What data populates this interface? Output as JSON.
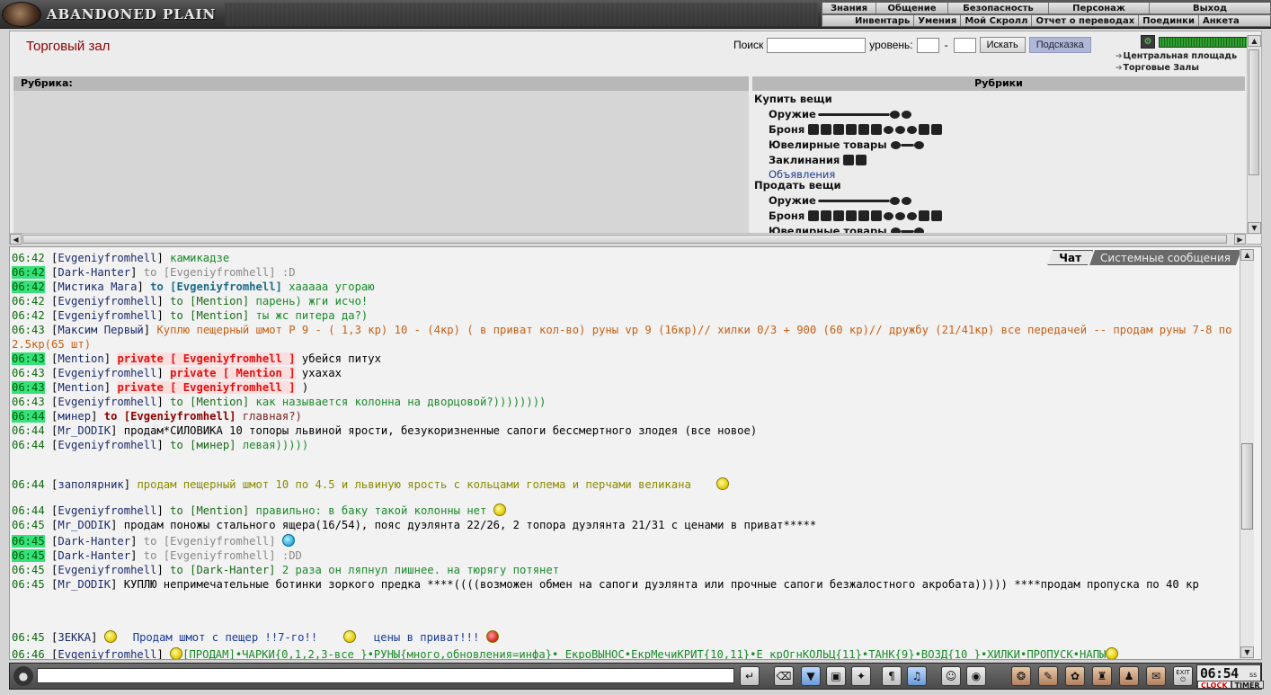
{
  "app": {
    "logo_text": "ABANDONED PLAIN"
  },
  "menu": {
    "top": [
      "Знания",
      "Общение",
      "Безопасность",
      "Персонаж",
      "Выход"
    ],
    "bottom": [
      "Инвентарь",
      "Умения",
      "Мой Скролл",
      "Отчет о переводах",
      "Поединки",
      "Анкета"
    ]
  },
  "page": {
    "title": "Торговый зал"
  },
  "search": {
    "label": "Поиск",
    "level_label": "уровень:",
    "dash": "-",
    "search_button": "Искать",
    "hint_button": "Подсказка"
  },
  "locations": [
    "Центральная площадь",
    "Торговые Залы"
  ],
  "rubric": {
    "header": "Рубрика:"
  },
  "rubrics": {
    "header": "Рубрики",
    "buy": "Купить вещи",
    "sell": "Продать вещи",
    "weapons": "Оружие",
    "armor": "Броня",
    "jewelry": "Ювелирные товары",
    "spells": "Заклинания",
    "ads": "Объявления"
  },
  "chat_tabs": {
    "chat": "Чат",
    "system": "Системные сообщения"
  },
  "chat": [
    {
      "time": "06:42",
      "hl": false,
      "nick": "Evgeniyfromhell",
      "to": "",
      "to_style": "",
      "msg": "камикадзе",
      "msg_style": "green"
    },
    {
      "time": "06:42",
      "hl": true,
      "nick": "Dark-Hanter",
      "to": "to [Evgeniyfromhell]",
      "to_style": "g",
      "msg": ":D",
      "msg_style": "gray"
    },
    {
      "time": "06:42",
      "hl": true,
      "nick": "Мистика Мага",
      "to": "to [Evgeniyfromhell]",
      "to_style": "bl",
      "msg": "хааааа угораю",
      "msg_style": "green"
    },
    {
      "time": "06:42",
      "hl": false,
      "nick": "Evgeniyfromhell",
      "to": "to [Mention]",
      "to_style": "",
      "msg": "парень) жги исчо!",
      "msg_style": "green"
    },
    {
      "time": "06:42",
      "hl": false,
      "nick": "Evgeniyfromhell",
      "to": "to [Mention]",
      "to_style": "",
      "msg": "ты жс питера да?)",
      "msg_style": "green"
    },
    {
      "time": "06:43",
      "hl": false,
      "nick": "Максим Первый",
      "to": "",
      "to_style": "",
      "msg": "Куплю пещерный шмот Р 9 - ( 1,3 кр) 10 - (4кр) ( в приват кол-во) руны vp 9 (16кр)// хилки 0/3 + 900 (60 кр)// дружбу (21/41кр) все передачей -- продам руны 7-8 по 2.5кр(65 шт)",
      "msg_style": "orange"
    },
    {
      "time": "06:43",
      "hl": true,
      "nick": "Mention",
      "to": "private [ Evgeniyfromhell ]",
      "to_style": "pv",
      "msg": "убейся питух",
      "msg_style": "black"
    },
    {
      "time": "06:43",
      "hl": false,
      "nick": "Evgeniyfromhell",
      "to": "private [ Mention ]",
      "to_style": "pv",
      "msg": "ухахах",
      "msg_style": "black"
    },
    {
      "time": "06:43",
      "hl": true,
      "nick": "Mention",
      "to": "private [ Evgeniyfromhell ]",
      "to_style": "pv",
      "msg": ")",
      "msg_style": "black"
    },
    {
      "time": "06:43",
      "hl": false,
      "nick": "Evgeniyfromhell",
      "to": "to [Mention]",
      "to_style": "",
      "msg": "как называется колонна на дворцовой?))))))))",
      "msg_style": "green"
    },
    {
      "time": "06:44",
      "hl": true,
      "nick": "минер",
      "to": "to [Evgeniyfromhell]",
      "to_style": "dk",
      "msg": "главная?)",
      "msg_style": "brown"
    },
    {
      "time": "06:44",
      "hl": false,
      "nick": "Mr_DODIK",
      "to": "",
      "to_style": "",
      "msg": "продам*СИЛОВИКА 10 топоры львиной ярости, безукоризненные сапоги бессмертного злодея (все новое)",
      "msg_style": "black"
    },
    {
      "time": "06:44",
      "hl": false,
      "nick": "Evgeniyfromhell",
      "to": "to [минер]",
      "to_style": "",
      "msg": "левая)))))",
      "msg_style": "green"
    },
    {
      "time": "06:44",
      "hl": false,
      "nick": "заполярник",
      "to": "",
      "to_style": "",
      "msg": "продам пещерный шмот 10 по 4.5 и львиную ярость с кольцами голема и перчами великана",
      "msg_style": "olive"
    },
    {
      "time": "06:44",
      "hl": false,
      "nick": "Evgeniyfromhell",
      "to": "to [Mention]",
      "to_style": "",
      "msg": "правильно: в баку такой колонны нет",
      "msg_style": "green"
    },
    {
      "time": "06:45",
      "hl": false,
      "nick": "Mr_DODIK",
      "to": "",
      "to_style": "",
      "msg": "продам поножы стального ящера(16/54), пояс дуэлянта 22/26, 2 топора дуэлянта 21/31 с ценами в приват*****",
      "msg_style": "black"
    },
    {
      "time": "06:45",
      "hl": true,
      "nick": "Dark-Hanter",
      "to": "to [Evgeniyfromhell]",
      "to_style": "g",
      "msg": "",
      "msg_style": "gray"
    },
    {
      "time": "06:45",
      "hl": true,
      "nick": "Dark-Hanter",
      "to": "to [Evgeniyfromhell]",
      "to_style": "g",
      "msg": ":DD",
      "msg_style": "gray"
    },
    {
      "time": "06:45",
      "hl": false,
      "nick": "Evgeniyfromhell",
      "to": "to [Dark-Hanter]",
      "to_style": "",
      "msg": "2 раза он ляпнул лишнее. на тюрягу потянет",
      "msg_style": "green"
    },
    {
      "time": "06:45",
      "hl": false,
      "nick": "Mr_DODIK",
      "to": "",
      "to_style": "",
      "msg": "КУПЛЮ непримечательные ботинки зоркого предка ****((((возможен обмен на сапоги дуэлянта или прочные сапоги безжалостного акробата))))) ****продам пропуска по 40 кр",
      "msg_style": "black"
    },
    {
      "time": "06:45",
      "hl": false,
      "nick": "ЗЕККА",
      "to": "",
      "to_style": "",
      "msg": "Продам шмот с пещер !!7-го!!",
      "msg2": "цены в приват!!!",
      "msg_style": "blue"
    },
    {
      "time": "06:46",
      "hl": false,
      "nick": "Evgeniyfromhell",
      "to": "",
      "to_style": "",
      "msg": "[ПРОДАМ]•ЧАРКИ{0,1,2,3-все }•РУНЫ{много,обновления=инфа}• ЕкроВЫНОС•ЕкрМечиКРИТ{10,11}•Е крОгнКОЛЬЦ{11}•ТАНК{9}•ВОЗД{10 }•ХИЛКИ•ПРОПУСК•НАПЫ",
      "msg_style": "green"
    }
  ],
  "clock": {
    "time": "06:54",
    "ss": "ss",
    "clock_label": "CLOCK",
    "timer_label": "TIMER",
    "exit_label": "EXIT"
  }
}
